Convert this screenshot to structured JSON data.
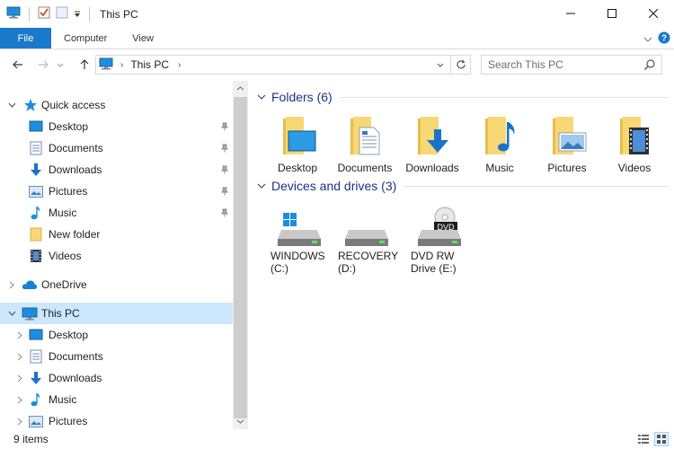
{
  "window": {
    "title": "This PC"
  },
  "ribbon": {
    "tabs": [
      "File",
      "Computer",
      "View"
    ]
  },
  "address": {
    "location": "This PC"
  },
  "search": {
    "placeholder": "Search This PC"
  },
  "nav": {
    "quick_access": "Quick access",
    "quick_items": [
      "Desktop",
      "Documents",
      "Downloads",
      "Pictures",
      "Music",
      "New folder",
      "Videos"
    ],
    "onedrive": "OneDrive",
    "this_pc": "This PC",
    "pc_items": [
      "Desktop",
      "Documents",
      "Downloads",
      "Music",
      "Pictures"
    ]
  },
  "content": {
    "folders_title": "Folders (6)",
    "folders": [
      "Desktop",
      "Documents",
      "Downloads",
      "Music",
      "Pictures",
      "Videos"
    ],
    "drives_title": "Devices and drives (3)",
    "drives": [
      {
        "name": "WINDOWS\n(C:)"
      },
      {
        "name": "RECOVERY\n(D:)"
      },
      {
        "name": "DVD RW\nDrive (E:)",
        "badge": "DVD"
      }
    ]
  },
  "status": {
    "count": "9 items"
  },
  "colors": {
    "accent": "#1979ca",
    "selection": "#cce8ff",
    "group_title": "#1e3287",
    "folder": "#f8d775"
  }
}
